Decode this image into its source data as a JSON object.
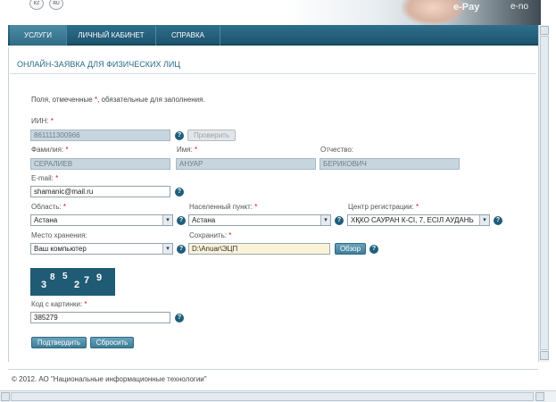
{
  "header": {
    "languages": [
      "KZ",
      "RU"
    ],
    "banner_text_1": "e-Pay",
    "banner_text_2": "e-no"
  },
  "nav": {
    "tabs": [
      {
        "label": "УСЛУГИ",
        "active": true
      },
      {
        "label": "ЛИЧНЫЙ КАБИНЕТ",
        "active": false
      },
      {
        "label": "СПРАВКА",
        "active": false
      }
    ]
  },
  "page": {
    "title": "ОНЛАЙН-ЗАЯВКА ДЛЯ ФИЗИЧЕСКИХ ЛИЦ",
    "note_prefix": "Поля, отмеченные",
    "note_star": "*",
    "note_suffix": ", обязательные для заполнения."
  },
  "form": {
    "iin": {
      "label": "ИИН:",
      "required": "*",
      "value": "861111300966",
      "check_button": "Проверить"
    },
    "surname": {
      "label": "Фамилия:",
      "required": "*",
      "value": "СЕРАЛИЕВ"
    },
    "name": {
      "label": "Имя:",
      "required": "*",
      "value": "АНУАР"
    },
    "patronymic": {
      "label": "Отчество:",
      "value": "БЕРИКОВИЧ"
    },
    "email": {
      "label": "E-mail:",
      "required": "*",
      "value": "shamanic@mail.ru"
    },
    "region": {
      "label": "Область:",
      "required": "*",
      "value": "Астана"
    },
    "locality": {
      "label": "Населенный пункт:",
      "required": "*",
      "value": "Астана"
    },
    "reg_center": {
      "label": "Центр регистрации:",
      "required": "*",
      "value": "ХҚКО САУРАН К-СІ, 7, ЕСІЛ АУДАНЬ"
    },
    "storage": {
      "label": "Место хранения:",
      "value": "Ваш компьютер"
    },
    "save": {
      "label": "Сохранить:",
      "required": "*",
      "value": "D:\\Anuar\\ЭЦП",
      "browse_button": "Обзор"
    },
    "captcha": {
      "digits": [
        "3",
        "8",
        "5",
        "2",
        "7",
        "9"
      ]
    },
    "captcha_code": {
      "label": "Код с картинки:",
      "required": "*",
      "value": "385279"
    },
    "submit_button": "Подтвердить",
    "reset_button": "Сбросить"
  },
  "footer": {
    "copyright": "© 2012. АО \"Национальные информационные технологии\""
  },
  "icons": {
    "help": "?",
    "dropdown": "▾"
  }
}
